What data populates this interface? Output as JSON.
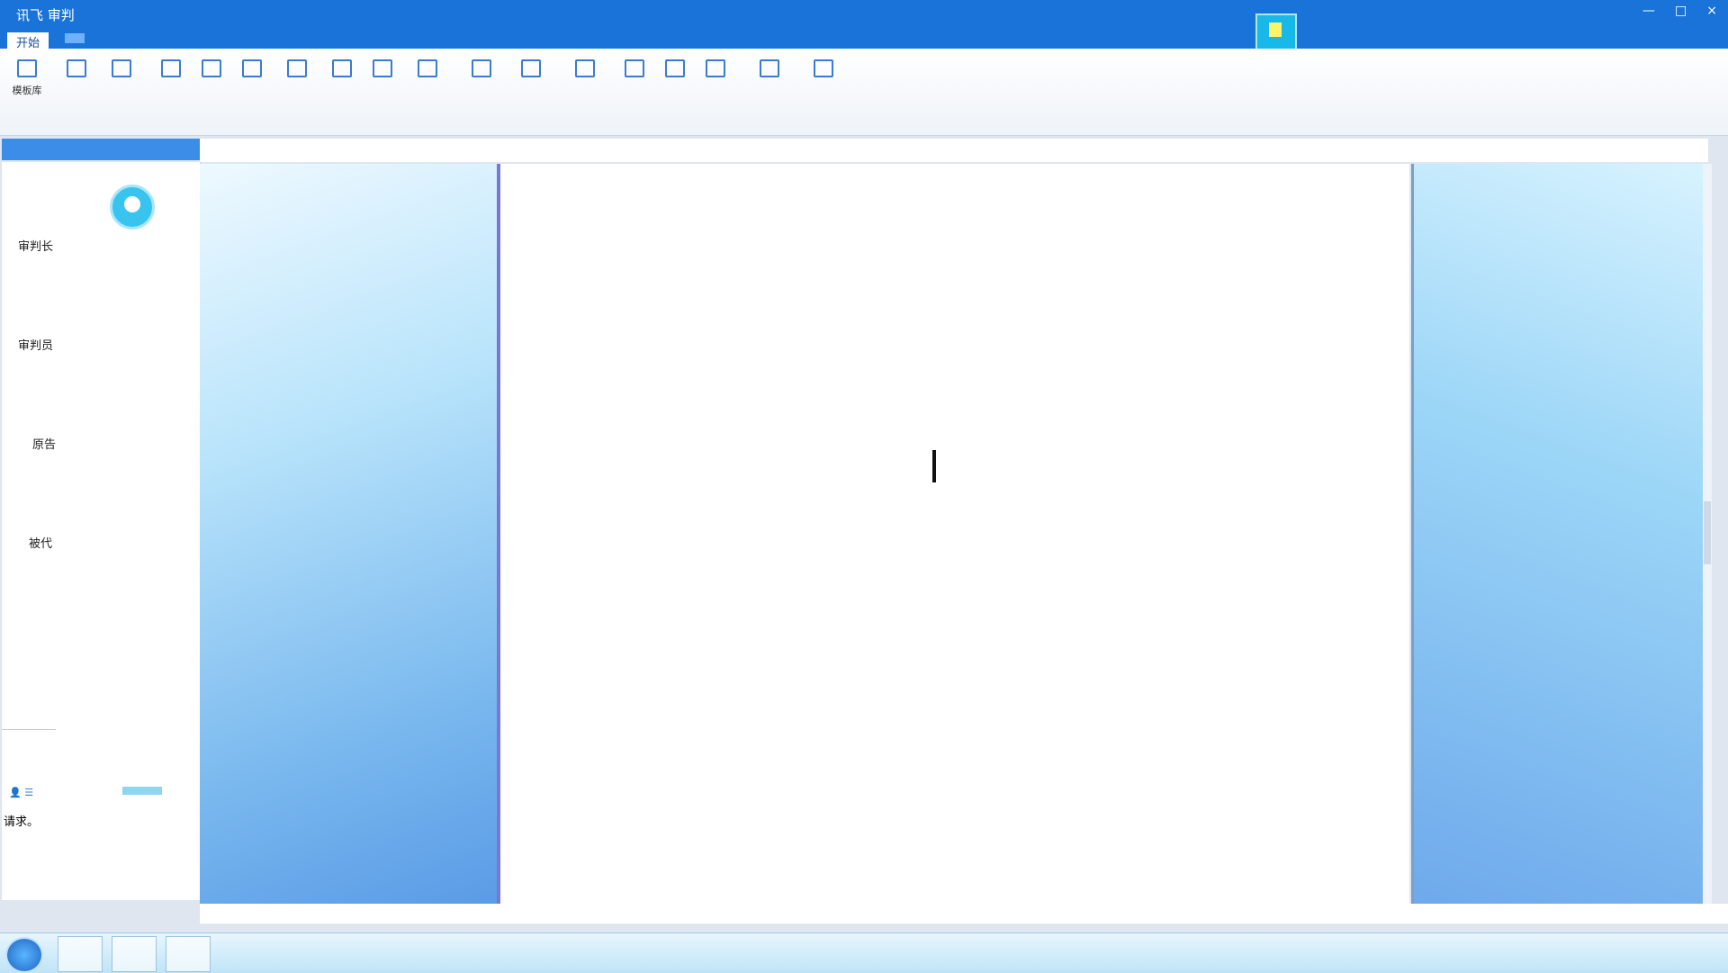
{
  "window": {
    "app_title": "讯飞 审判",
    "doc_title": "",
    "controls": [
      "—",
      "□",
      "×"
    ],
    "right_label": "",
    "tabs": {
      "start": "开始"
    }
  },
  "ribbon": {
    "tools": [
      {
        "label": "模板库",
        "icon": "template-icon"
      },
      {
        "label": "",
        "icon": "document-icon"
      },
      {
        "label": "",
        "icon": "folder-icon"
      },
      {
        "label": "",
        "icon": "page-icon"
      },
      {
        "label": "",
        "icon": "pause-icon"
      },
      {
        "label": "",
        "icon": "bracket-icon"
      },
      {
        "label": "",
        "icon": "format-icon"
      },
      {
        "label": "",
        "icon": "text-icon"
      },
      {
        "label": "",
        "icon": "grid-icon"
      },
      {
        "label": "",
        "icon": "eye-icon"
      },
      {
        "label": "",
        "icon": "link-icon"
      },
      {
        "label": "",
        "icon": "list-icon"
      },
      {
        "label": "",
        "icon": "square-icon"
      },
      {
        "label": "",
        "icon": "flag-icon"
      },
      {
        "label": "",
        "icon": "edit-icon"
      },
      {
        "label": "",
        "icon": "box-icon"
      },
      {
        "label": "",
        "icon": "settings-icon"
      },
      {
        "label": "",
        "icon": "info-icon"
      }
    ],
    "group_labels": [
      "",
      "",
      "",
      "",
      ""
    ]
  },
  "left_panel": {
    "tab_label": "",
    "rows": [
      {
        "label": "审判长",
        "value": ""
      },
      {
        "label": "审判员",
        "value": ""
      },
      {
        "label": "原告",
        "value": ""
      },
      {
        "label": "被代",
        "value": ""
      }
    ],
    "footer_a": "",
    "footer_b": "",
    "request_text": "请求。"
  },
  "doc_header": {
    "left": "",
    "mid": "",
    "right": ""
  },
  "document": {
    "lines": [
      "",
      "",
      "",
      "",
      "",
      "",
      "",
      "",
      "",
      "",
      "",
      "",
      "",
      "",
      "",
      ""
    ]
  },
  "statusbar": {
    "left": "",
    "right": ""
  },
  "taskbar": {
    "tray": ""
  }
}
